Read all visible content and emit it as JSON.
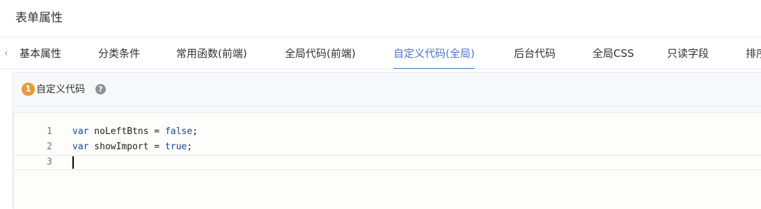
{
  "header": {
    "title": "表单属性"
  },
  "tabs": {
    "prev_icon": "chevron-left-icon",
    "items": [
      {
        "label": "基本属性"
      },
      {
        "label": "分类条件"
      },
      {
        "label": "常用函数(前端)"
      },
      {
        "label": "全局代码(前端)"
      },
      {
        "label": "自定义代码(全局)",
        "active": true
      },
      {
        "label": "后台代码"
      },
      {
        "label": "全局CSS"
      },
      {
        "label": "只读字段"
      },
      {
        "label": "排序"
      }
    ]
  },
  "section": {
    "step": "1",
    "title": "自定义代码",
    "help_icon": "question-circle-icon",
    "help_glyph": "?"
  },
  "editor": {
    "lines": [
      {
        "number": "1",
        "keyword": "var",
        "name": " noLeftBtns = ",
        "value": "false",
        "end": ";"
      },
      {
        "number": "2",
        "keyword": "var",
        "name": " showImport = ",
        "value": "true",
        "end": ";"
      },
      {
        "number": "3",
        "keyword": "",
        "name": "",
        "value": "",
        "end": ""
      }
    ],
    "current_line": 3
  },
  "colors": {
    "accent": "#4a76c8",
    "step_badge": "#e89b32",
    "keyword": "#1a3fa8"
  }
}
